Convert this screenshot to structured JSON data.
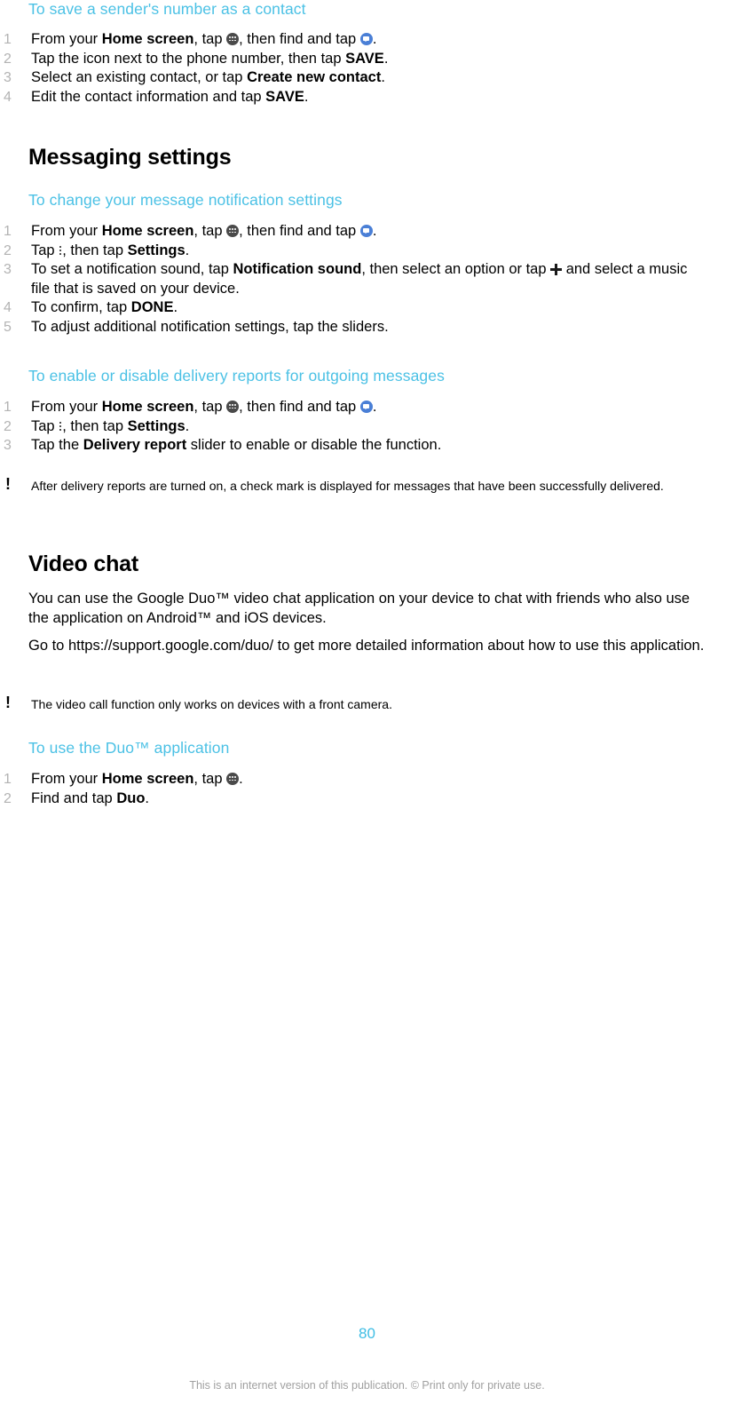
{
  "page": {
    "number": "80",
    "disclaimer": "This is an internet version of this publication. © Print only for private use.",
    "accent_cyan": "#4bc1e5",
    "accent_gray_number": "#b3b3b3",
    "icon_apps_color": "#4a4a4a",
    "icon_message_color": "#4a7fd6"
  },
  "sections": {
    "save_sender": {
      "heading": "To save a sender's number as a contact",
      "steps": [
        {
          "parts": [
            {
              "t": "From your "
            },
            {
              "t": "Home screen",
              "b": true
            },
            {
              "t": ", tap "
            },
            {
              "icon": "apps-grid-icon"
            },
            {
              "t": ", then find and tap "
            },
            {
              "icon": "messaging-icon"
            },
            {
              "t": "."
            }
          ]
        },
        {
          "parts": [
            {
              "t": "Tap the icon next to the phone number, then tap "
            },
            {
              "t": "SAVE",
              "b": true
            },
            {
              "t": "."
            }
          ]
        },
        {
          "parts": [
            {
              "t": "Select an existing contact, or tap "
            },
            {
              "t": "Create new contact",
              "b": true
            },
            {
              "t": "."
            }
          ]
        },
        {
          "parts": [
            {
              "t": "Edit the contact information and tap "
            },
            {
              "t": "SAVE",
              "b": true
            },
            {
              "t": "."
            }
          ]
        }
      ]
    },
    "messaging_settings": {
      "title": "Messaging settings"
    },
    "notification_settings": {
      "heading": "To change your message notification settings",
      "steps": [
        {
          "parts": [
            {
              "t": "From your "
            },
            {
              "t": "Home screen",
              "b": true
            },
            {
              "t": ", tap "
            },
            {
              "icon": "apps-grid-icon"
            },
            {
              "t": ", then find and tap "
            },
            {
              "icon": "messaging-icon"
            },
            {
              "t": "."
            }
          ]
        },
        {
          "parts": [
            {
              "t": "Tap "
            },
            {
              "icon": "overflow-menu-icon"
            },
            {
              "t": ", then tap "
            },
            {
              "t": "Settings",
              "b": true
            },
            {
              "t": "."
            }
          ]
        },
        {
          "parts": [
            {
              "t": "To set a notification sound, tap "
            },
            {
              "t": "Notification sound",
              "b": true
            },
            {
              "t": ", then select an option or tap "
            },
            {
              "icon": "plus-icon"
            },
            {
              "t": " and select a music file that is saved on your device."
            }
          ]
        },
        {
          "parts": [
            {
              "t": "To confirm, tap "
            },
            {
              "t": "DONE",
              "b": true
            },
            {
              "t": "."
            }
          ]
        },
        {
          "parts": [
            {
              "t": "To adjust additional notification settings, tap the sliders."
            }
          ]
        }
      ]
    },
    "delivery_reports": {
      "heading": "To enable or disable delivery reports for outgoing messages",
      "steps": [
        {
          "parts": [
            {
              "t": "From your "
            },
            {
              "t": "Home screen",
              "b": true
            },
            {
              "t": ", tap "
            },
            {
              "icon": "apps-grid-icon"
            },
            {
              "t": ", then find and tap "
            },
            {
              "icon": "messaging-icon"
            },
            {
              "t": "."
            }
          ]
        },
        {
          "parts": [
            {
              "t": "Tap "
            },
            {
              "icon": "overflow-menu-icon"
            },
            {
              "t": ", then tap "
            },
            {
              "t": "Settings",
              "b": true
            },
            {
              "t": "."
            }
          ]
        },
        {
          "parts": [
            {
              "t": "Tap the "
            },
            {
              "t": "Delivery report",
              "b": true
            },
            {
              "t": " slider to enable or disable the function."
            }
          ]
        }
      ],
      "note": "After delivery reports are turned on, a check mark is displayed for messages that have been successfully delivered."
    },
    "video_chat": {
      "title": "Video chat",
      "paragraph_1": "You can use the Google Duo™ video chat application on your device to chat with friends who also use the application on Android™ and iOS devices.",
      "paragraph_2": "Go to https://support.google.com/duo/ to get more detailed information about how to use this application.",
      "note": "The video call function only works on devices with a front camera."
    },
    "duo_application": {
      "heading": "To use the Duo™ application",
      "steps": [
        {
          "parts": [
            {
              "t": "From your "
            },
            {
              "t": "Home screen",
              "b": true
            },
            {
              "t": ", tap "
            },
            {
              "icon": "apps-grid-icon"
            },
            {
              "t": "."
            }
          ]
        },
        {
          "parts": [
            {
              "t": "Find and tap "
            },
            {
              "t": "Duo",
              "b": true
            },
            {
              "t": "."
            }
          ]
        }
      ]
    }
  }
}
